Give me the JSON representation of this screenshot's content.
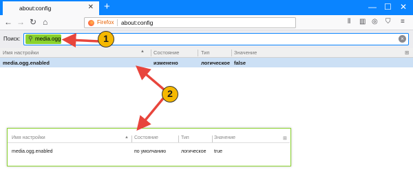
{
  "browser": {
    "tab_title": "about:config",
    "tab_close": "✕",
    "new_tab": "+",
    "window_controls": [
      "—",
      "☐",
      "✕"
    ],
    "url_label": "Firefox",
    "url": "about:config"
  },
  "search": {
    "label": "Поиск:",
    "value": "media.ogg"
  },
  "table": {
    "columns": [
      "Имя настройки",
      "Состояние",
      "Тип",
      "Значение"
    ],
    "selected_row": {
      "name": "media.ogg.enabled",
      "state": "изменено",
      "type": "логическое",
      "value": "false"
    }
  },
  "inset": {
    "columns": [
      "Имя настройки",
      "Состояние",
      "Тип",
      "Значение"
    ],
    "row": {
      "name": "media.ogg.enabled",
      "state": "по умолчанию",
      "type": "логическое",
      "value": "true"
    }
  },
  "annotations": {
    "badge_1": "1",
    "badge_2": "2"
  },
  "colors": {
    "tabbar": "#0a84ff",
    "highlight": "#8ad22e",
    "selected_row": "#cce0f5",
    "arrow": "#e8453c",
    "badge": "#f5b800"
  }
}
